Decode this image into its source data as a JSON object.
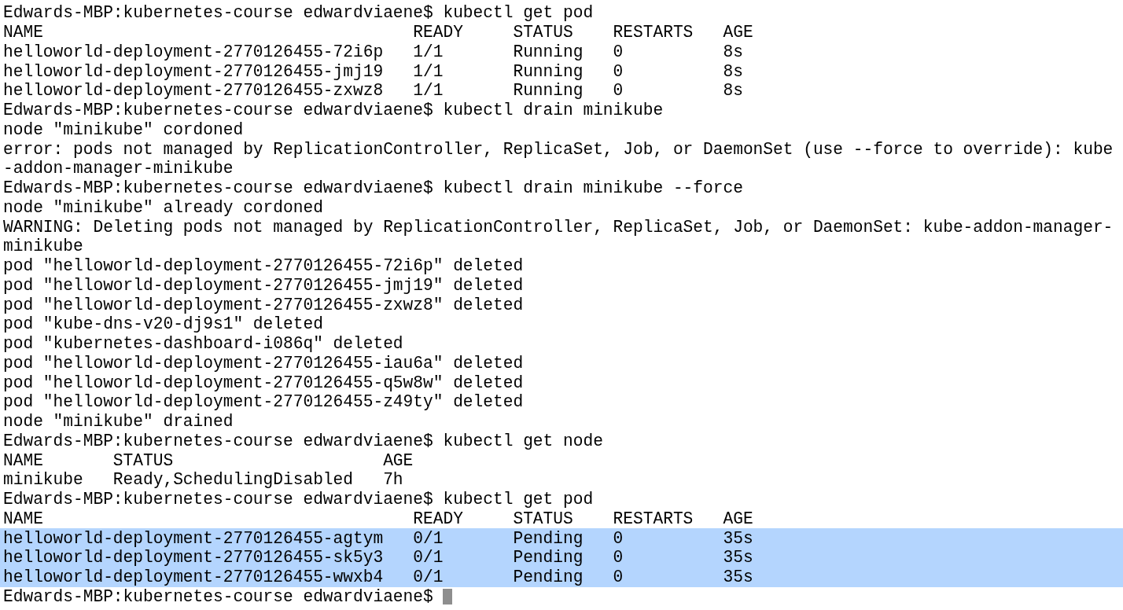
{
  "terminal": {
    "cursor_visible": true,
    "lines": [
      {
        "text": "Edwards-MBP:kubernetes-course edwardviaene$ kubectl get pod",
        "selected": false
      },
      {
        "text": "NAME                                     READY     STATUS    RESTARTS   AGE",
        "selected": false
      },
      {
        "text": "helloworld-deployment-2770126455-72i6p   1/1       Running   0          8s",
        "selected": false
      },
      {
        "text": "helloworld-deployment-2770126455-jmj19   1/1       Running   0          8s",
        "selected": false
      },
      {
        "text": "helloworld-deployment-2770126455-zxwz8   1/1       Running   0          8s",
        "selected": false
      },
      {
        "text": "Edwards-MBP:kubernetes-course edwardviaene$ kubectl drain minikube",
        "selected": false
      },
      {
        "text": "node \"minikube\" cordoned",
        "selected": false
      },
      {
        "text": "error: pods not managed by ReplicationController, ReplicaSet, Job, or DaemonSet (use --force to override): kube",
        "selected": false
      },
      {
        "text": "-addon-manager-minikube",
        "selected": false
      },
      {
        "text": "Edwards-MBP:kubernetes-course edwardviaene$ kubectl drain minikube --force",
        "selected": false
      },
      {
        "text": "node \"minikube\" already cordoned",
        "selected": false
      },
      {
        "text": "WARNING: Deleting pods not managed by ReplicationController, ReplicaSet, Job, or DaemonSet: kube-addon-manager-",
        "selected": false
      },
      {
        "text": "minikube",
        "selected": false
      },
      {
        "text": "pod \"helloworld-deployment-2770126455-72i6p\" deleted",
        "selected": false
      },
      {
        "text": "pod \"helloworld-deployment-2770126455-jmj19\" deleted",
        "selected": false
      },
      {
        "text": "pod \"helloworld-deployment-2770126455-zxwz8\" deleted",
        "selected": false
      },
      {
        "text": "pod \"kube-dns-v20-dj9s1\" deleted",
        "selected": false
      },
      {
        "text": "pod \"kubernetes-dashboard-i086q\" deleted",
        "selected": false
      },
      {
        "text": "pod \"helloworld-deployment-2770126455-iau6a\" deleted",
        "selected": false
      },
      {
        "text": "pod \"helloworld-deployment-2770126455-q5w8w\" deleted",
        "selected": false
      },
      {
        "text": "pod \"helloworld-deployment-2770126455-z49ty\" deleted",
        "selected": false
      },
      {
        "text": "node \"minikube\" drained",
        "selected": false
      },
      {
        "text": "Edwards-MBP:kubernetes-course edwardviaene$ kubectl get node",
        "selected": false
      },
      {
        "text": "NAME       STATUS                     AGE",
        "selected": false
      },
      {
        "text": "minikube   Ready,SchedulingDisabled   7h",
        "selected": false
      },
      {
        "text": "Edwards-MBP:kubernetes-course edwardviaene$ kubectl get pod",
        "selected": false
      },
      {
        "text": "NAME                                     READY     STATUS    RESTARTS   AGE",
        "selected": false
      },
      {
        "text": "helloworld-deployment-2770126455-agtym   0/1       Pending   0          35s",
        "selected": true
      },
      {
        "text": "helloworld-deployment-2770126455-sk5y3   0/1       Pending   0          35s",
        "selected": true
      },
      {
        "text": "helloworld-deployment-2770126455-wwxb4   0/1       Pending   0          35s",
        "selected": true
      },
      {
        "text": "Edwards-MBP:kubernetes-course edwardviaene$",
        "selected": false
      }
    ]
  }
}
